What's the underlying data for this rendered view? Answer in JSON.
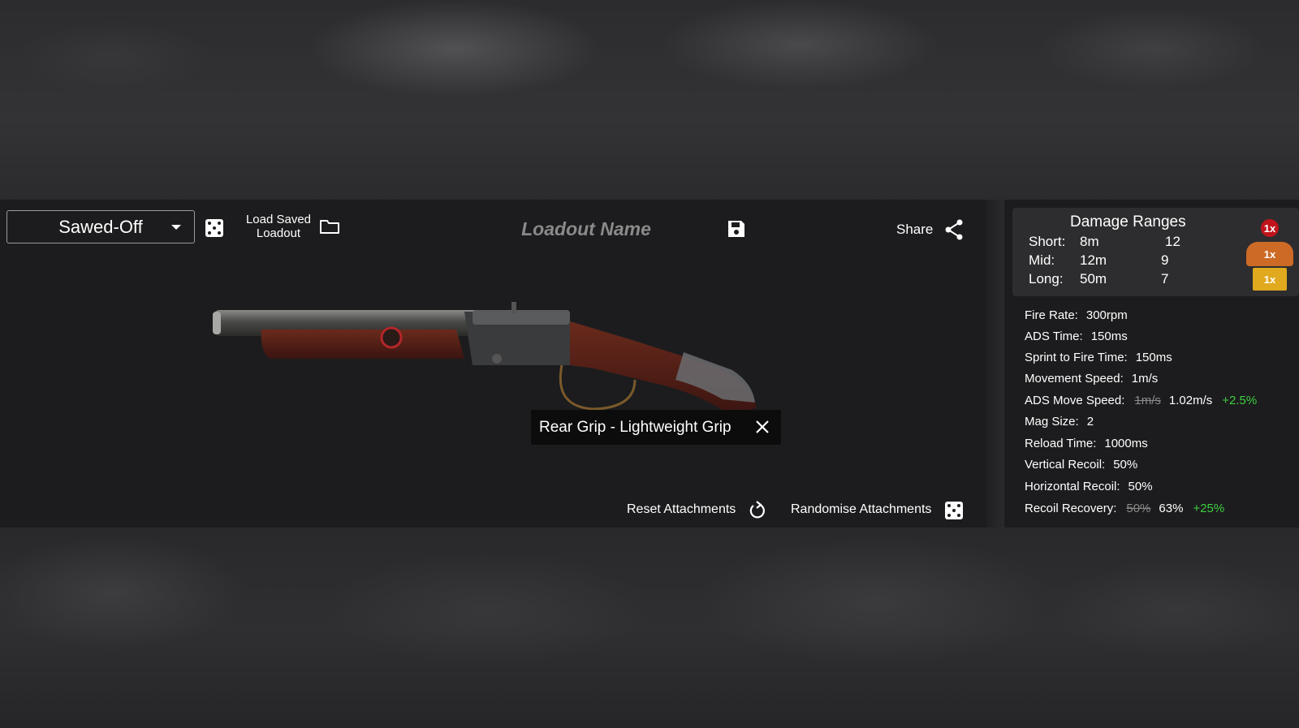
{
  "toolbar": {
    "weapon_selected": "Sawed-Off",
    "load_saved_label": "Load Saved Loadout",
    "loadout_name_placeholder": "Loadout Name",
    "share_label": "Share"
  },
  "tooltip": {
    "text": "Rear Grip - Lightweight Grip"
  },
  "actions": {
    "reset_label": "Reset Attachments",
    "randomise_label": "Randomise Attachments"
  },
  "damage_ranges": {
    "title": "Damage Ranges",
    "rows": [
      {
        "label": "Short:",
        "range": "8m",
        "damage": "12"
      },
      {
        "label": "Mid:",
        "range": "12m",
        "damage": "9"
      },
      {
        "label": "Long:",
        "range": "50m",
        "damage": "7"
      }
    ],
    "multipliers": [
      {
        "zone": "head",
        "value": "1x",
        "color": "#c0141c"
      },
      {
        "zone": "chest",
        "value": "1x",
        "color": "#cc6a26"
      },
      {
        "zone": "legs",
        "value": "1x",
        "color": "#e0a91e"
      }
    ]
  },
  "stats": [
    {
      "label": "Fire Rate:",
      "value": "300rpm"
    },
    {
      "label": "ADS Time:",
      "value": "150ms"
    },
    {
      "label": "Sprint to Fire Time:",
      "value": "150ms"
    },
    {
      "label": "Movement Speed:",
      "value": "1m/s"
    },
    {
      "label": "ADS Move Speed:",
      "old": "1m/s",
      "value": "1.02m/s",
      "change": "+2.5%"
    },
    {
      "label": "Mag Size:",
      "value": "2"
    },
    {
      "label": "Reload Time:",
      "value": "1000ms"
    },
    {
      "label": "Vertical Recoil:",
      "value": "50%"
    },
    {
      "label": "Horizontal Recoil:",
      "value": "50%"
    },
    {
      "label": "Recoil Recovery:",
      "old": "50%",
      "value": "63%",
      "change": "+25%"
    }
  ],
  "colors": {
    "panel_bg": "#1c1c1e",
    "damage_box_bg": "#2d2d2f",
    "positive_change": "#3ecf3e",
    "strike_text": "#8a8a8a"
  },
  "icons": [
    "dice-icon",
    "folder-icon",
    "save-icon",
    "share-icon",
    "close-icon",
    "reset-icon"
  ]
}
